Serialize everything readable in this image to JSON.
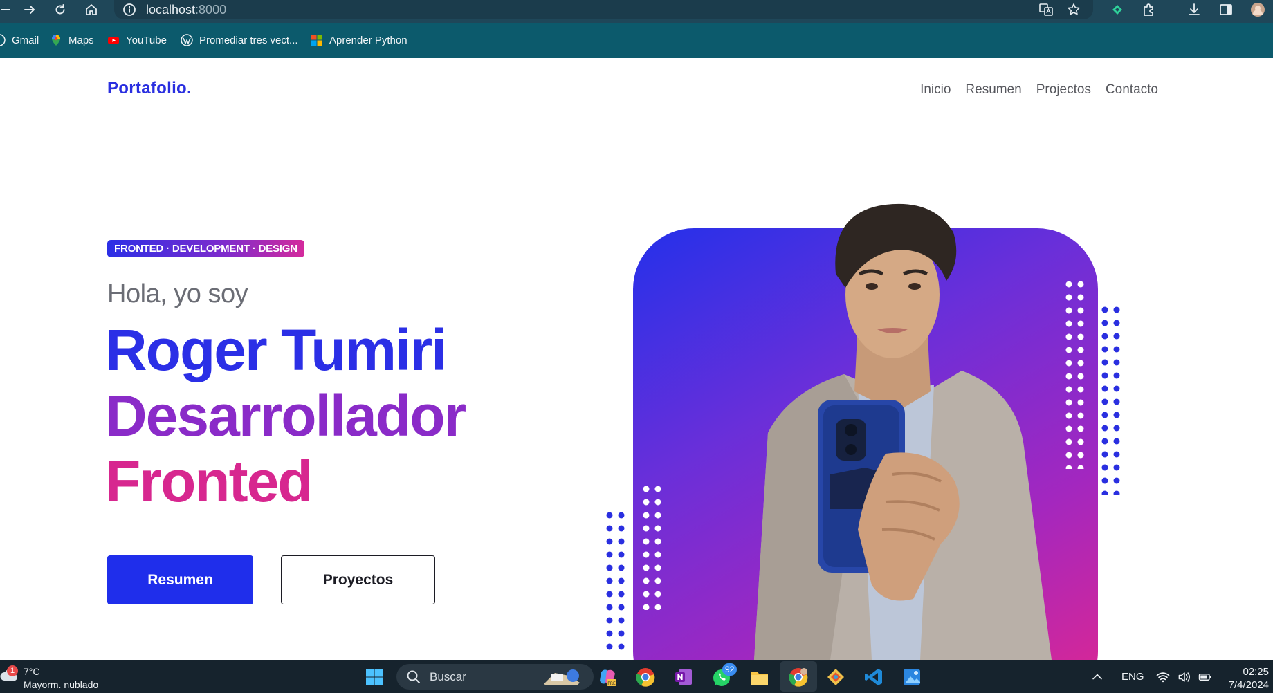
{
  "browser": {
    "url_host": "localhost",
    "url_port": ":8000",
    "bookmarks": [
      {
        "label": "Gmail",
        "icon": "gmail-icon"
      },
      {
        "label": "Maps",
        "icon": "maps-icon"
      },
      {
        "label": "YouTube",
        "icon": "youtube-icon"
      },
      {
        "label": "Promediar tres vect...",
        "icon": "wordpress-icon"
      },
      {
        "label": "Aprender Python",
        "icon": "microsoft-icon"
      }
    ]
  },
  "site": {
    "logo": "Portafolio.",
    "nav": [
      "Inicio",
      "Resumen",
      "Projectos",
      "Contacto"
    ]
  },
  "hero": {
    "tagline": "FRONTED · DEVELOPMENT · DESIGN",
    "greeting": "Hola, yo soy",
    "line1": "Roger Tumiri",
    "line2": "Desarrollador",
    "line3": "Fronted",
    "primary_button": "Resumen",
    "secondary_button": "Proyectos"
  },
  "taskbar": {
    "weather_temp": "7°C",
    "weather_desc": "Mayorm. nublado",
    "weather_badge": "1",
    "search_placeholder": "Buscar",
    "whatsapp_badge": "92",
    "language": "ENG",
    "time": "02:25",
    "date": "7/4/2024"
  },
  "colors": {
    "brand_blue": "#2b2fe6",
    "brand_purple": "#8a2bc8",
    "brand_pink": "#d7278f",
    "toolbar": "#1f4759",
    "bookmarks_bar": "#0c5a6c",
    "taskbar": "#16232d"
  }
}
